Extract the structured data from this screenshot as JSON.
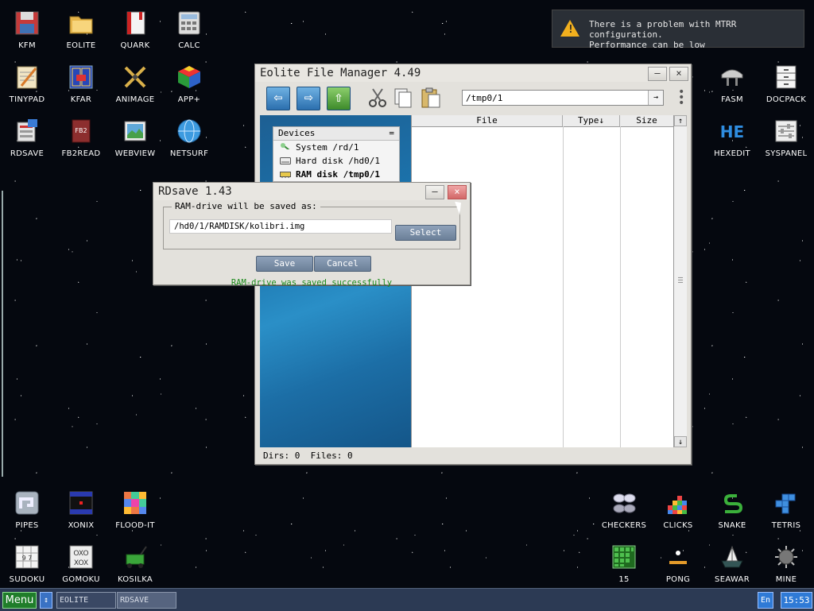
{
  "desktop": {
    "icons": [
      {
        "label": "KFM",
        "icon": "floppy-icon"
      },
      {
        "label": "EOLITE",
        "icon": "folder-icon"
      },
      {
        "label": "QUARK",
        "icon": "notebook-icon"
      },
      {
        "label": "CALC",
        "icon": "calculator-icon"
      },
      {
        "label": "TINYPAD",
        "icon": "notepad-icon"
      },
      {
        "label": "KFAR",
        "icon": "kfar-icon"
      },
      {
        "label": "ANIMAGE",
        "icon": "brush-icon"
      },
      {
        "label": "APP+",
        "icon": "rubiks-cube-icon"
      },
      {
        "label": "RDSAVE",
        "icon": "rdsave-icon"
      },
      {
        "label": "FB2READ",
        "icon": "book-icon"
      },
      {
        "label": "WEBVIEW",
        "icon": "map-icon"
      },
      {
        "label": "NETSURF",
        "icon": "globe-icon"
      },
      {
        "label": "FASM",
        "icon": "fasm-icon"
      },
      {
        "label": "DOCPACK",
        "icon": "drawer-icon"
      },
      {
        "label": "HEXEDIT",
        "icon": "hex-icon"
      },
      {
        "label": "SYSPANEL",
        "icon": "sliders-icon"
      },
      {
        "label": "PIPES",
        "icon": "pipes-icon"
      },
      {
        "label": "XONIX",
        "icon": "xonix-icon"
      },
      {
        "label": "FLOOD-IT",
        "icon": "flood-it-icon"
      },
      {
        "label": "SUDOKU",
        "icon": "sudoku-icon"
      },
      {
        "label": "GOMOKU",
        "icon": "gomoku-icon"
      },
      {
        "label": "KOSILKA",
        "icon": "lawnmower-icon"
      },
      {
        "label": "CHECKERS",
        "icon": "checkers-icon"
      },
      {
        "label": "CLICKS",
        "icon": "clicks-icon"
      },
      {
        "label": "SNAKE",
        "icon": "snake-icon"
      },
      {
        "label": "TETRIS",
        "icon": "tetris-icon"
      },
      {
        "label": "15",
        "icon": "fifteen-icon"
      },
      {
        "label": "PONG",
        "icon": "pong-icon"
      },
      {
        "label": "SEAWAR",
        "icon": "ship-icon"
      },
      {
        "label": "MINE",
        "icon": "mine-icon"
      }
    ]
  },
  "notification": {
    "line1": "There is a problem with MTRR configuration.",
    "line2": "Performance can be low",
    "icon": "warning-icon"
  },
  "eolite": {
    "title": "Eolite File Manager 4.49",
    "path": "/tmp0/1",
    "devices_header": "Devices",
    "devices_menu_glyph": "=",
    "devices": [
      {
        "label": "System /rd/1",
        "icon": "system-disk-icon"
      },
      {
        "label": "Hard disk /hd0/1",
        "icon": "hard-disk-icon"
      },
      {
        "label": "RAM disk /tmp0/1",
        "icon": "ram-disk-icon"
      }
    ],
    "columns": {
      "file": "File",
      "type": "Type↓",
      "size": "Size"
    },
    "status": "Dirs: 0  Files: 0"
  },
  "rdsave": {
    "title": "RDsave 1.43",
    "group_label": "RAM-drive will be saved as:",
    "path_value": "/hd0/1/RAMDISK/kolibri.img",
    "select_label": "Select",
    "save_label": "Save",
    "cancel_label": "Cancel",
    "message": "RAM-drive was saved successfully"
  },
  "taskbar": {
    "menu_label": "Menu",
    "tasks": [
      "EOLITE",
      "RDSAVE"
    ],
    "lang": "En",
    "clock": "15:53"
  },
  "colors": {
    "success": "#1c8a1c",
    "close_button": "#d26767",
    "menu_button": "#1f7d2a",
    "taskbar": "#2c3a54"
  }
}
